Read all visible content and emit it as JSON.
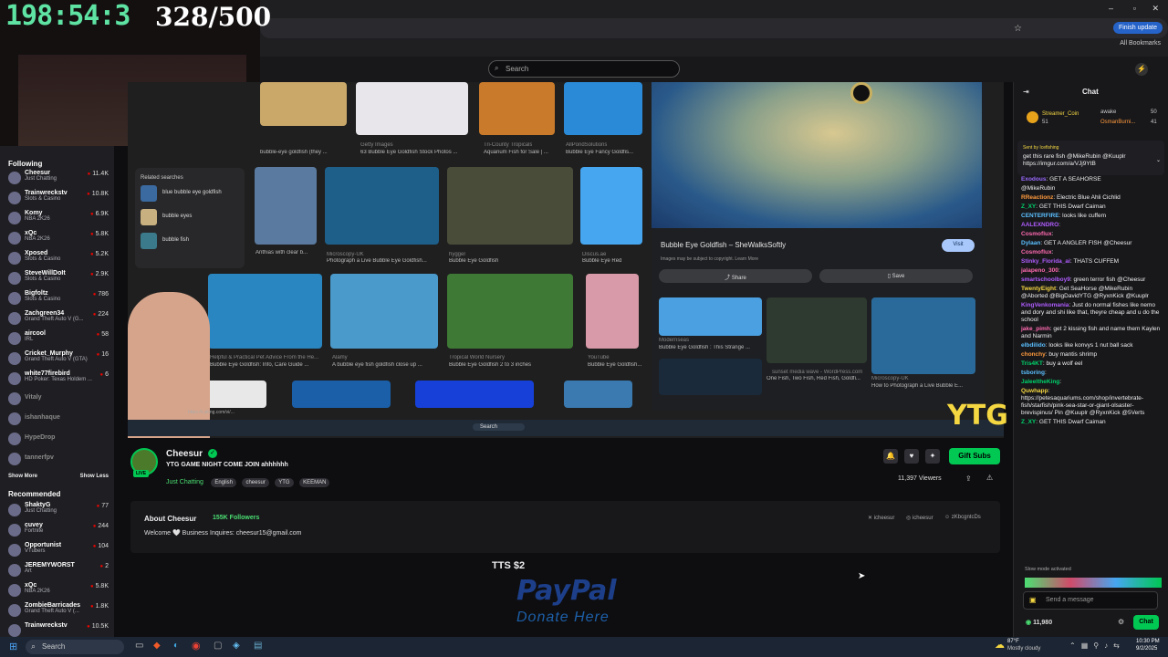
{
  "overlay": {
    "timer": "198:54:3",
    "counter": "328/500"
  },
  "browser": {
    "finish_update": "Finish update",
    "all_bookmarks": "All Bookmarks"
  },
  "twitch": {
    "search_placeholder": "Search"
  },
  "sidebar": {
    "following_title": "Following",
    "following": [
      {
        "name": "Cheesur",
        "game": "Just Chatting",
        "viewers": "11.4K"
      },
      {
        "name": "Trainwreckstv",
        "game": "Slots & Casino",
        "viewers": "10.8K"
      },
      {
        "name": "Komy",
        "game": "NBA 2K26",
        "viewers": "6.9K"
      },
      {
        "name": "xQc",
        "game": "NBA 2K26",
        "viewers": "5.8K"
      },
      {
        "name": "Xposed",
        "game": "Slots & Casino",
        "viewers": "5.2K"
      },
      {
        "name": "SteveWillDoIt",
        "game": "Slots & Casino",
        "viewers": "2.9K"
      },
      {
        "name": "Bigfoltz",
        "game": "Slots & Casino",
        "viewers": "786"
      },
      {
        "name": "Zachgreen34",
        "game": "Grand Theft Auto V (G...",
        "viewers": "224"
      },
      {
        "name": "aircool",
        "game": "IRL",
        "viewers": "58"
      },
      {
        "name": "Cricket_Murphy",
        "game": "Grand Theft Auto V (GTA)",
        "viewers": "16"
      },
      {
        "name": "white77firebird",
        "game": "HD Poker: Texas Holdem ...",
        "viewers": "6"
      }
    ],
    "offline": [
      "Vitaly",
      "ishanhaque",
      "HypeDrop",
      "tannerfpv"
    ],
    "show_more": "Show More",
    "show_less": "Show Less",
    "recommended_title": "Recommended",
    "recommended": [
      {
        "name": "ShaktyG",
        "game": "Just Chatting",
        "viewers": "77"
      },
      {
        "name": "cuvey",
        "game": "Fortnite",
        "viewers": "244"
      },
      {
        "name": "Opportunist",
        "game": "VTubers",
        "viewers": "104"
      },
      {
        "name": "JEREMYWORST",
        "game": "Art",
        "viewers": "2"
      },
      {
        "name": "xQc",
        "game": "NBA 2K26",
        "viewers": "5.8K"
      },
      {
        "name": "ZombieBarricades",
        "game": "Grand Theft Auto V (...",
        "viewers": "1.8K"
      },
      {
        "name": "Trainwreckstv",
        "game": "",
        "viewers": "10.5K"
      }
    ]
  },
  "stream_content": {
    "related_title": "Related searches",
    "related": [
      "blue bubble eye goldfish",
      "bubble eyes",
      "bubble fish"
    ],
    "captions": [
      "bubble-eye goldfish (they ...",
      "Bubble Eye Goldfish",
      "Getty Images",
      "63 Bubble Eye Goldfish Stock Photos ...",
      "Tri-County Tropicals",
      "Aquarium Fish for Sale | ...",
      "AllPondSolutions",
      "Bubble Eye Fancy Goldfis...",
      "Reef2Reef",
      "Anthias with clear b...",
      "Microscopy-UK",
      "Photograph a Live Bubble Eye Goldfish...",
      "hygger",
      "Bubble Eye Goldfish",
      "Discus.ae",
      "Bubble Eye Red",
      "Helpful & Practical Pet Advice From the He...",
      "Bubble Eye Goldfish: Info, Care Guide ...",
      "Alamy",
      "A bubble eye fish goldfish close up ...",
      "Tropical World Nursery",
      "Bubble Eye Goldfish 2 to 3 inches",
      "YouTube",
      "Bubble Eye Goldfish..."
    ],
    "detail_title": "Bubble Eye Goldfish – SheWalksSoftly",
    "detail_visit": "Visit",
    "detail_note": "Images may be subject to copyright. Learn More",
    "detail_share": "Share",
    "detail_save": "Save",
    "detail_caps": [
      "Modernseas",
      "Bubble Eye Goldfish : This Strange ...",
      "sunset media wave - WordPress.com",
      "One Fish, Two Fish, Red Fish, Goldfi...",
      "Microscopy-UK",
      "How to Photograph a Live Bubble E..."
    ],
    "url_text": "https://i.ytimg.com/vi/...",
    "inner_search": "Search",
    "watermark": "YTG"
  },
  "channel": {
    "name": "Cheesur",
    "title": "YTG GAME NIGHT COME JOIN ahhhhhh",
    "category": "Just Chatting",
    "tags": [
      "English",
      "cheesur",
      "YTG",
      "KEEMAN"
    ],
    "gift_subs": "Gift Subs",
    "viewers": "11,397 Viewers",
    "about_title": "About Cheesur",
    "followers": "155K Followers",
    "about_body": "Welcome 🤍 Business Inquires: cheesur15@gmail.com",
    "socials": [
      "icheesur",
      "icheesur",
      "zKbcgntcDs"
    ],
    "tts": "TTS $2",
    "paypal": "PayPal",
    "donate": "Donate Here",
    "live": "LIVE"
  },
  "chat": {
    "title": "Chat",
    "top1_name": "Streamer_Coin",
    "top1_val": "51",
    "top2_name": "awake",
    "top2_val": "50",
    "top3_name": "OsmanBurni...",
    "top3_val": "41",
    "pinned_by": "Sent by Icefishing",
    "pinned": "get this rare fish @MikeRubin @Kuuplr https://imgur.com/a/VJj9YtB",
    "messages": [
      {
        "u": "Exodous",
        "c": "#9b6bff",
        "t": "GET A SEAHORSE"
      },
      {
        "u": "",
        "c": "#fff",
        "t": "@MikeRubin"
      },
      {
        "u": "RReactionz",
        "c": "#ff9a3c",
        "t": "Electric Blue Ahli Cichlid"
      },
      {
        "u": "Z_XY",
        "c": "#00d26a",
        "t": "GET THIS Dwarf Caiman"
      },
      {
        "u": "CENTERFIRE",
        "c": "#5bc0ff",
        "t": "looks like cuffem"
      },
      {
        "u": "AALEXNDRO",
        "c": "#b05cff",
        "t": ""
      },
      {
        "u": "Cosmoflux",
        "c": "#ff6ab0",
        "t": ""
      },
      {
        "u": "Dylaan",
        "c": "#5bc0ff",
        "t": "GET A ANGLER FISH @Cheesur"
      },
      {
        "u": "Cosmoflux",
        "c": "#ff6ab0",
        "t": ""
      },
      {
        "u": "Stinky_Florida_ai",
        "c": "#b05cff",
        "t": "THATS CUFFEM"
      },
      {
        "u": "jalapeno_300",
        "c": "#ff6ab0",
        "t": ""
      },
      {
        "u": "smartschoolboy9",
        "c": "#b05cff",
        "t": "green terror fish @Cheesur"
      },
      {
        "u": "TwentyEight",
        "c": "#f5d742",
        "t": "Get SeaHorse @MikeRubin @Aborted @BigDavidYTG @RyxnKick @Kuuplr"
      },
      {
        "u": "KingVenkomania",
        "c": "#b05cff",
        "t": "Just do normal fishes like nemo and dory and shi like that, theyre cheap and u do the school"
      },
      {
        "u": "jake_pimh",
        "c": "#ff6ab0",
        "t": "get 2 kissing fish and name them Kaylen and Narmin"
      },
      {
        "u": "elbdilido",
        "c": "#5bc0ff",
        "t": "looks like konvys 1 nut ball sack"
      },
      {
        "u": "chonchy",
        "c": "#ff9a3c",
        "t": "buy mantis shrimp"
      },
      {
        "u": "Tris4KT",
        "c": "#00d26a",
        "t": "buy a wolf eel"
      },
      {
        "u": "tsboring",
        "c": "#5bc0ff",
        "t": ""
      },
      {
        "u": "JaleeltheKing",
        "c": "#00d26a",
        "t": ""
      },
      {
        "u": "Quwhapp",
        "c": "#f5d742",
        "t": "https://petesaquariums.com/shop/invertebrate-fish/starfish/pink-sea-star-or-giant-olsaster-brevispinus/ Pin @Kuuplr @RyxnKick @5Verts"
      },
      {
        "u": "Z_XY",
        "c": "#00d26a",
        "t": "GET THIS Dwarf Caiman"
      }
    ],
    "slow_mode": "Slow mode activated",
    "input_placeholder": "Send a message",
    "points": "11,980",
    "chat_button": "Chat"
  },
  "taskbar": {
    "search": "Search",
    "weather_temp": "87°F",
    "weather_desc": "Mostly cloudy",
    "time": "10:30 PM",
    "date": "9/2/2025"
  }
}
